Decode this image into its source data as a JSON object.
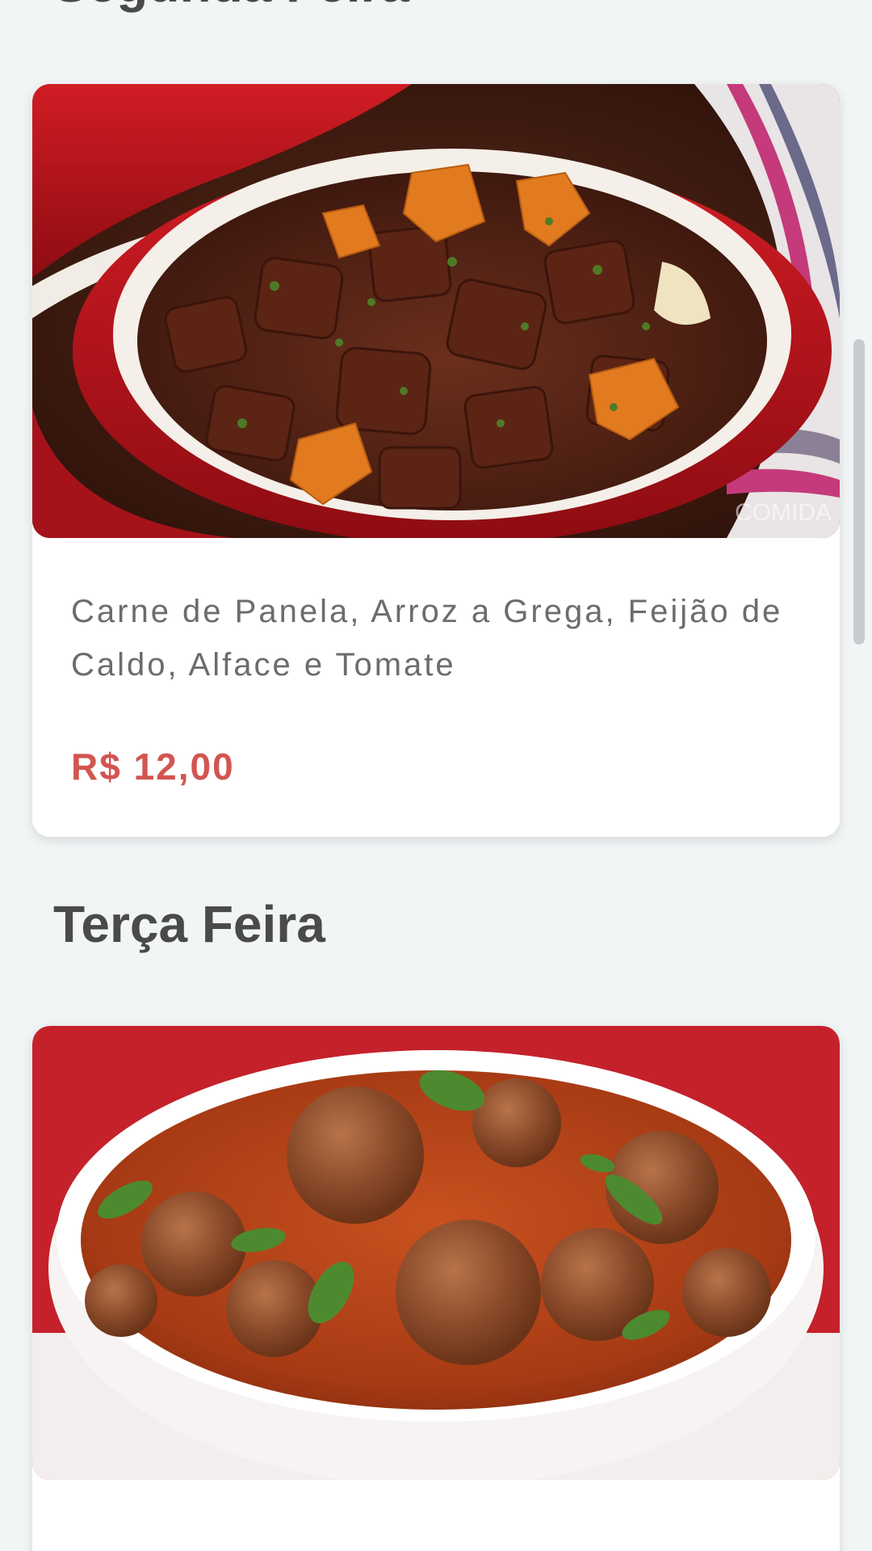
{
  "sections": [
    {
      "day_heading": "Segunda Feira",
      "dish": {
        "image_icon": "beef-stew-photo",
        "description": "Carne de Panela, Arroz a Grega, Feijão de Caldo, Alface e Tomate",
        "price": "R$ 12,00"
      }
    },
    {
      "day_heading": "Terça Feira",
      "dish": {
        "image_icon": "meatballs-photo"
      }
    }
  ],
  "colors": {
    "background": "#f2f5f6",
    "card": "#ffffff",
    "heading": "#4a4a4a",
    "description": "#6c6c6c",
    "price": "#d25551"
  }
}
